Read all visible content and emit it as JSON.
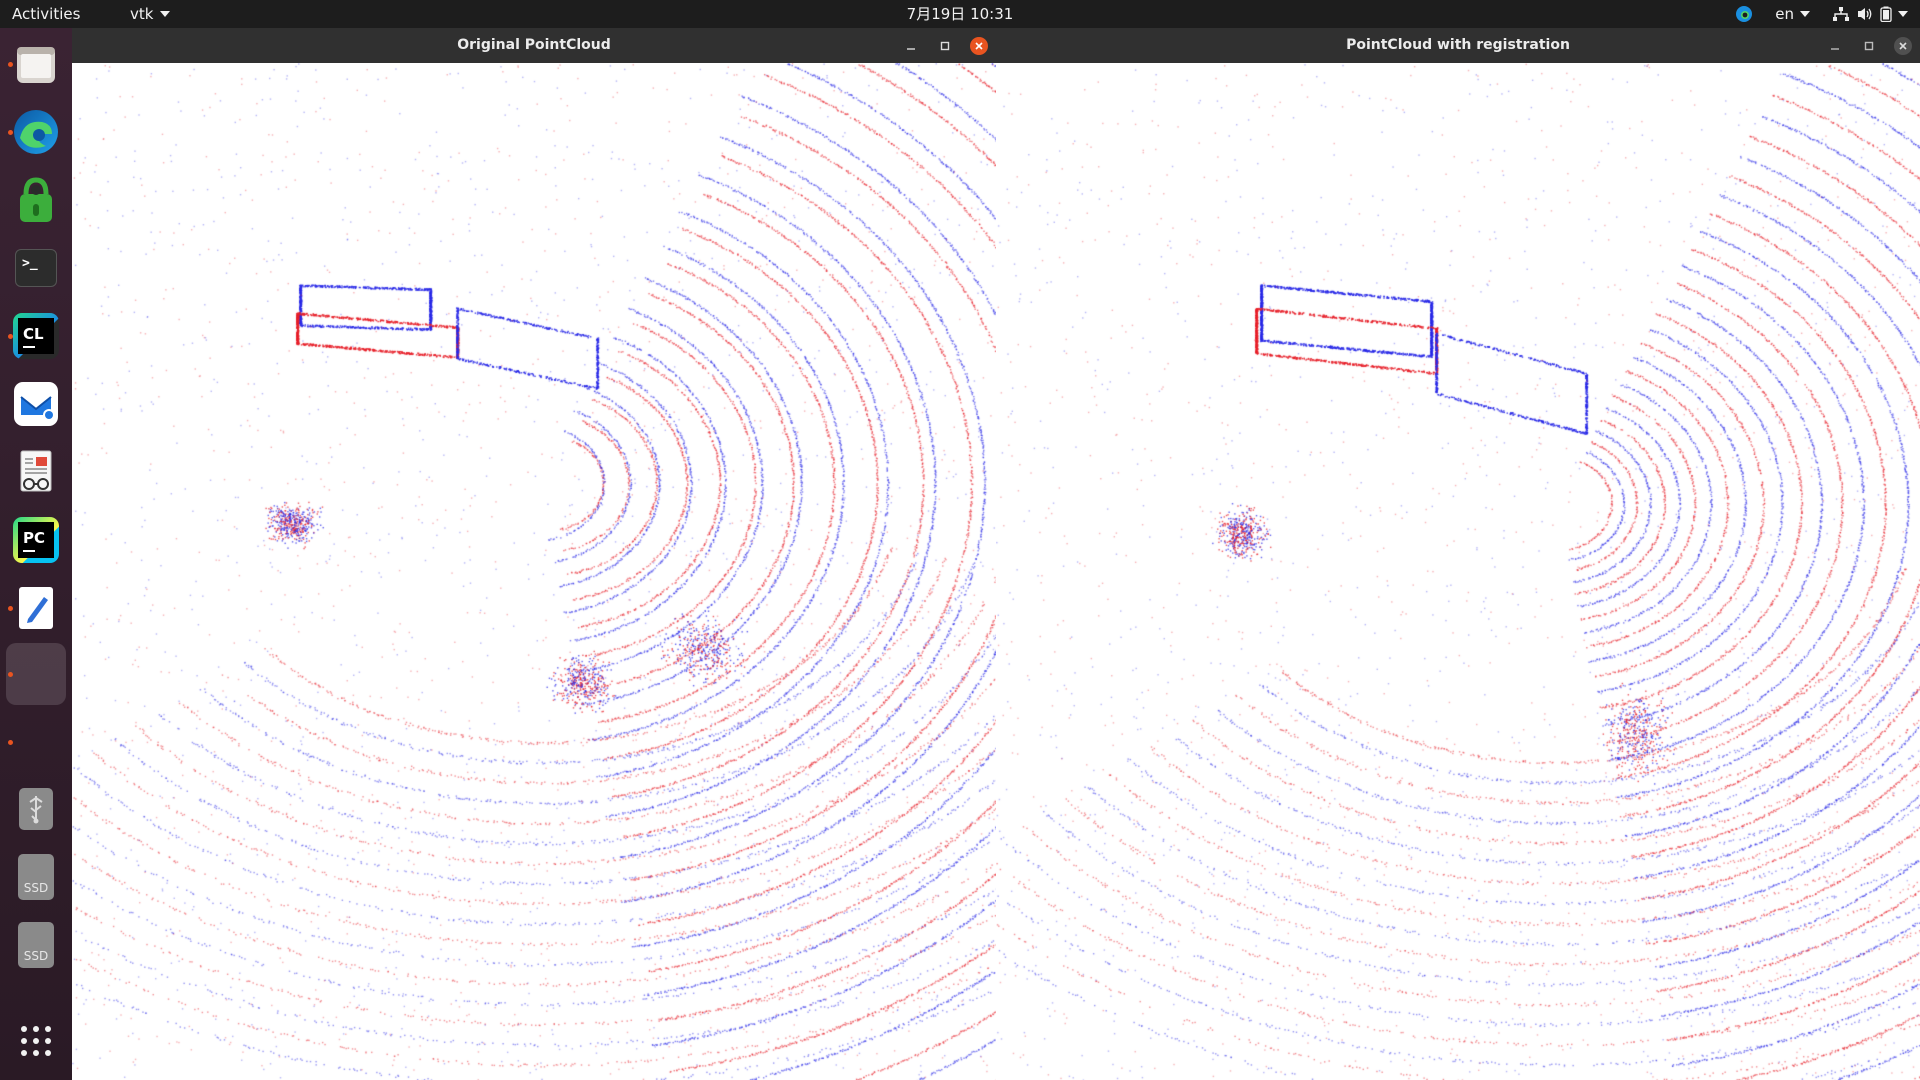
{
  "topbar": {
    "activities": "Activities",
    "app_menu": "vtk",
    "clock": "7月19日  10:31",
    "language": "en"
  },
  "dock": {
    "apps": [
      {
        "name": "files",
        "icon": "folder-icon",
        "running": true
      },
      {
        "name": "edge",
        "icon": "edge-browser-icon",
        "running": true
      },
      {
        "name": "vpn",
        "icon": "private-internet-access-icon",
        "running": false
      },
      {
        "name": "terminal",
        "icon": "terminal-icon",
        "running": false,
        "label": ">_"
      },
      {
        "name": "clion",
        "icon": "clion-icon",
        "running": true,
        "label": "CL"
      },
      {
        "name": "mail",
        "icon": "mail-client-icon",
        "running": false
      },
      {
        "name": "document-viewer",
        "icon": "document-viewer-icon",
        "running": false
      },
      {
        "name": "pycharm",
        "icon": "pycharm-icon",
        "running": false,
        "label": "PC"
      },
      {
        "name": "text-editor",
        "icon": "text-editor-icon",
        "running": true
      },
      {
        "name": "vtk-window",
        "icon": "vtk-window-icon",
        "running": true
      },
      {
        "name": "unnamed",
        "icon": "hidden-app-icon",
        "running": true
      },
      {
        "name": "usb",
        "icon": "usb-drive-icon",
        "running": false
      },
      {
        "name": "ssd1",
        "icon": "ssd-drive-icon",
        "running": false,
        "label": "SSD"
      },
      {
        "name": "ssd2",
        "icon": "ssd-drive-icon",
        "running": false,
        "label": "SSD"
      },
      {
        "name": "show-apps",
        "icon": "app-grid-icon",
        "running": false
      }
    ]
  },
  "windows": {
    "left": {
      "title": "Original PointCloud"
    },
    "right": {
      "title": "PointCloud with registration"
    }
  },
  "colors": {
    "cloud_a": "#e8202a",
    "cloud_b": "#2a2ae8",
    "close_active": "#e95420",
    "close_inactive": "#505050"
  }
}
